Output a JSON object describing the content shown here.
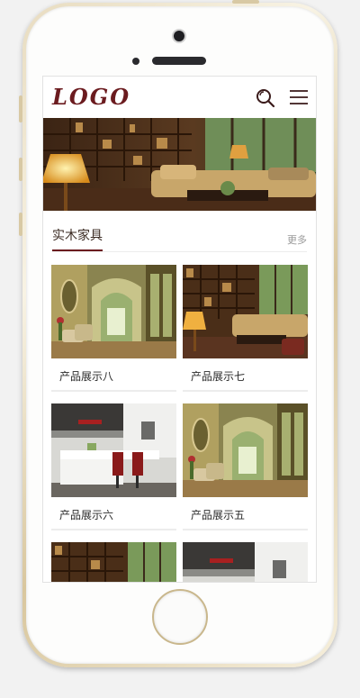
{
  "header": {
    "logo_text": "LOGO",
    "search_icon": "search-icon",
    "menu_icon": "hamburger-menu-icon"
  },
  "section": {
    "title": "实木家具",
    "more_label": "更多"
  },
  "products": [
    {
      "name": "产品展示八",
      "image": "hallway-interior"
    },
    {
      "name": "产品展示七",
      "image": "living-room-bookshelf"
    },
    {
      "name": "产品展示六",
      "image": "modern-kitchen"
    },
    {
      "name": "产品展示五",
      "image": "hallway-interior"
    },
    {
      "name": "",
      "image": "living-room-bookshelf"
    },
    {
      "name": "",
      "image": "modern-kitchen"
    }
  ],
  "colors": {
    "brand": "#6b1b1f",
    "frame_gold": "#d9c79e",
    "text_dark": "#2b2b2b",
    "muted": "#9a9a9a"
  }
}
